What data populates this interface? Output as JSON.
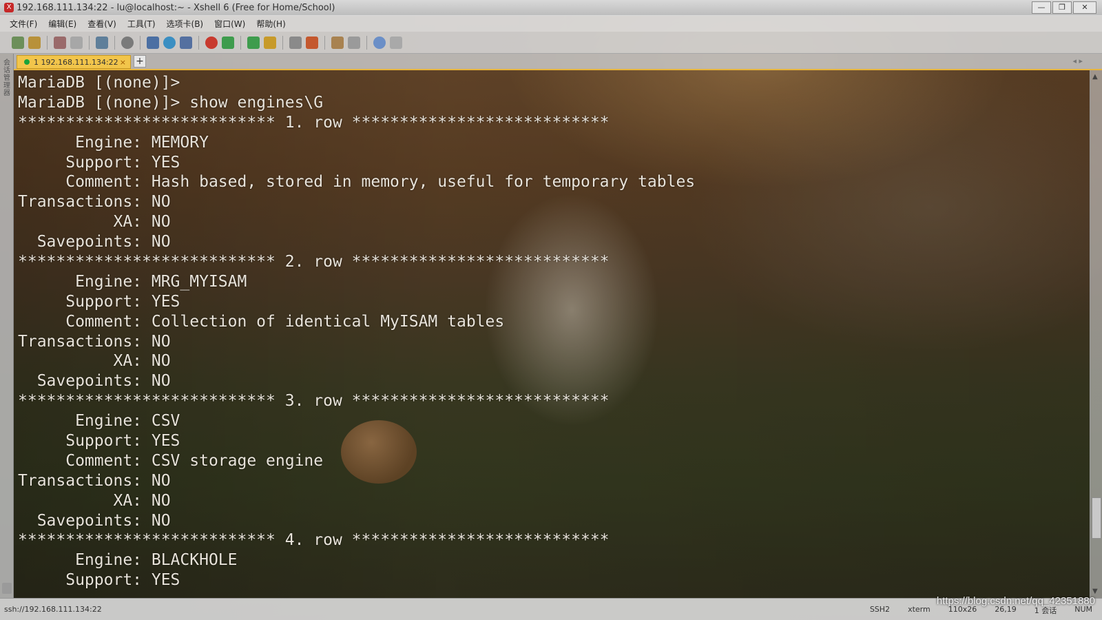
{
  "window": {
    "title": "192.168.111.134:22 - lu@localhost:~ - Xshell 6 (Free for Home/School)"
  },
  "menu": [
    "文件(F)",
    "编辑(E)",
    "查看(V)",
    "工具(T)",
    "选项卡(B)",
    "窗口(W)",
    "帮助(H)"
  ],
  "tab": {
    "label": "1 192.168.111.134:22",
    "close": "×",
    "add": "+"
  },
  "left_strip_label": "会话管理器",
  "terminal_lines": [
    "MariaDB [(none)]>",
    "MariaDB [(none)]> show engines\\G",
    "*************************** 1. row ***************************",
    "      Engine: MEMORY",
    "     Support: YES",
    "     Comment: Hash based, stored in memory, useful for temporary tables",
    "Transactions: NO",
    "          XA: NO",
    "  Savepoints: NO",
    "*************************** 2. row ***************************",
    "      Engine: MRG_MYISAM",
    "     Support: YES",
    "     Comment: Collection of identical MyISAM tables",
    "Transactions: NO",
    "          XA: NO",
    "  Savepoints: NO",
    "*************************** 3. row ***************************",
    "      Engine: CSV",
    "     Support: YES",
    "     Comment: CSV storage engine",
    "Transactions: NO",
    "          XA: NO",
    "  Savepoints: NO",
    "*************************** 4. row ***************************",
    "      Engine: BLACKHOLE",
    "     Support: YES"
  ],
  "status": {
    "left": "ssh://192.168.111.134:22",
    "protocol": "SSH2",
    "term": "xterm",
    "size": "110x26",
    "cursor": "26,19",
    "sessions": "1 会话",
    "num": "NUM"
  },
  "watermark": "https://blog.csdn.net/qq_42351880"
}
